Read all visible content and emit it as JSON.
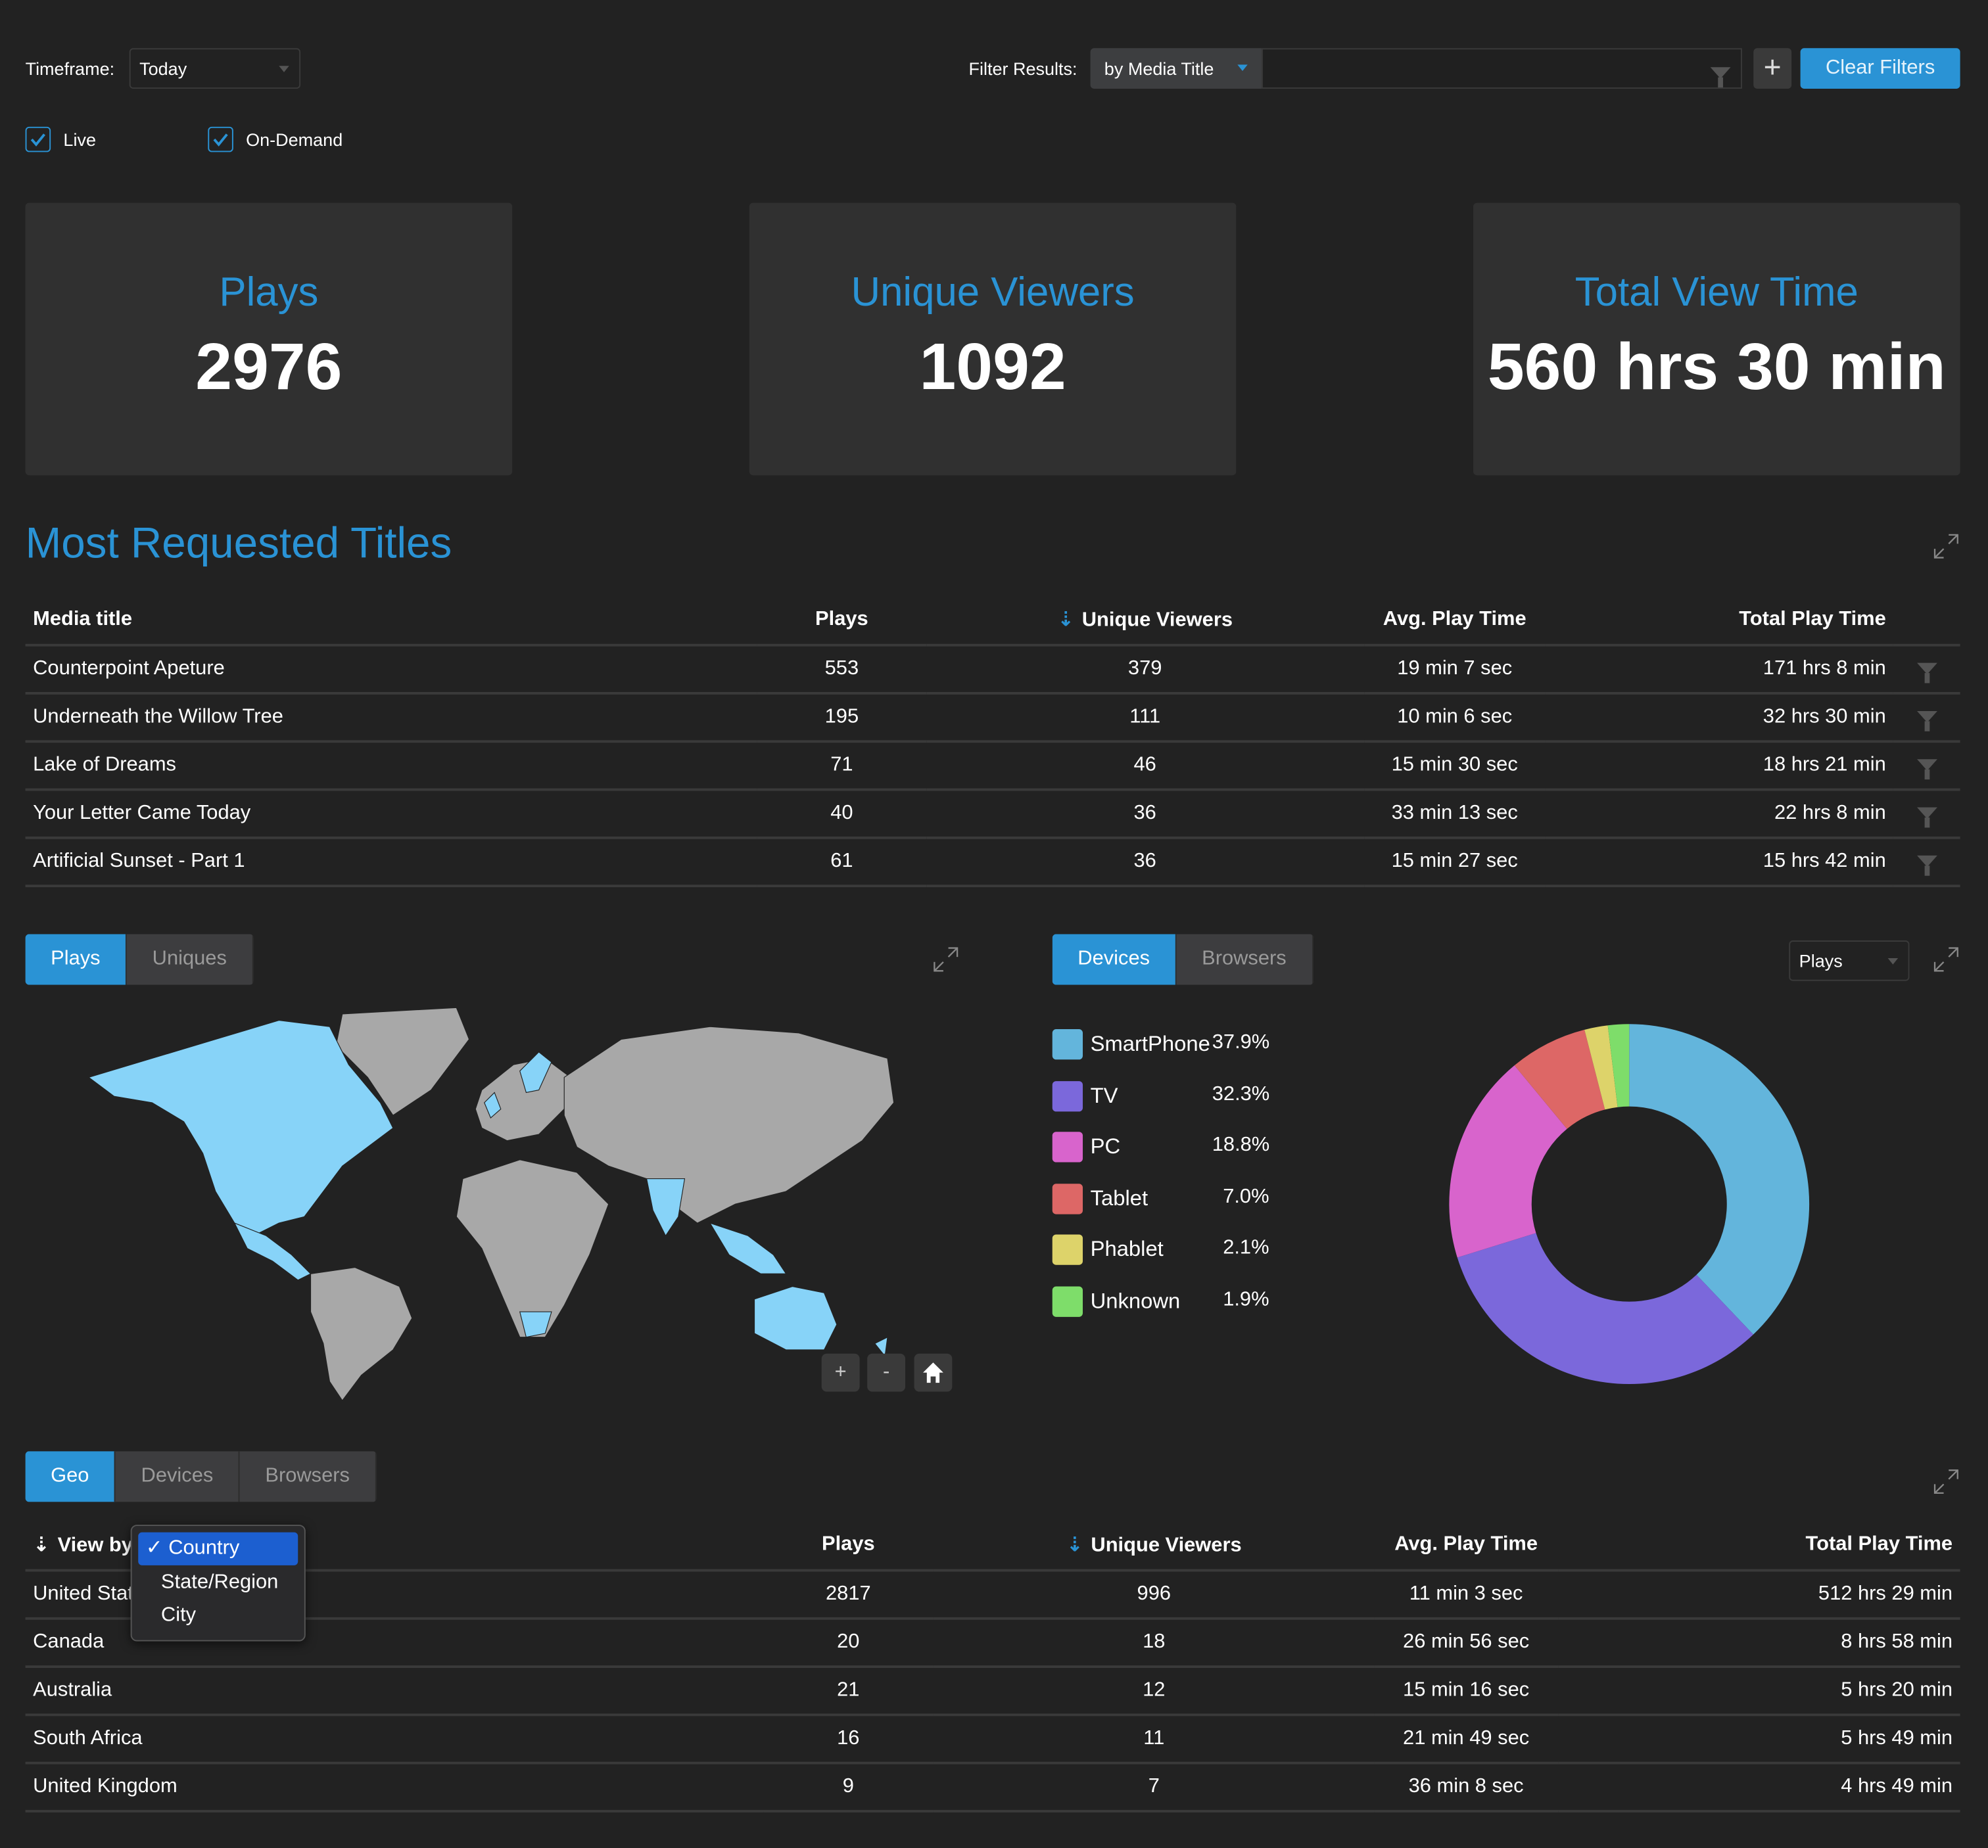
{
  "toolbar": {
    "timeframe_label": "Timeframe:",
    "timeframe_value": "Today",
    "filter_label": "Filter Results:",
    "filter_by_value": "by Media Title",
    "filter_input_value": "",
    "add_filter_label": "+",
    "clear_filters_label": "Clear Filters"
  },
  "checkboxes": [
    {
      "label": "Live",
      "checked": true
    },
    {
      "label": "On-Demand",
      "checked": true
    }
  ],
  "stats": [
    {
      "title": "Plays",
      "value": "2976"
    },
    {
      "title": "Unique Viewers",
      "value": "1092"
    },
    {
      "title": "Total View Time",
      "value": "560 hrs 30 min"
    }
  ],
  "titles_section": {
    "heading": "Most Requested Titles",
    "columns": [
      "Media title",
      "Plays",
      "Unique Viewers",
      "Avg. Play Time",
      "Total Play Time"
    ],
    "sorted_column": "Unique Viewers",
    "rows": [
      [
        "Counterpoint Apeture",
        "553",
        "379",
        "19 min 7 sec",
        "171 hrs 8 min"
      ],
      [
        "Underneath the Willow Tree",
        "195",
        "111",
        "10 min 6 sec",
        "32 hrs 30 min"
      ],
      [
        "Lake of Dreams",
        "71",
        "46",
        "15 min 30 sec",
        "18 hrs 21 min"
      ],
      [
        "Your Letter Came Today",
        "40",
        "36",
        "33 min 13 sec",
        "22 hrs 8 min"
      ],
      [
        "Artificial Sunset - Part 1",
        "61",
        "36",
        "15 min 27 sec",
        "15 hrs 42 min"
      ]
    ]
  },
  "map_panel": {
    "tabs": [
      "Plays",
      "Uniques"
    ],
    "active_tab": "Plays",
    "zoom_in": "+",
    "zoom_out": "-",
    "highlight_color": "#87d3f8",
    "land_color": "#a8a8a8"
  },
  "devices_panel": {
    "tabs": [
      "Devices",
      "Browsers"
    ],
    "active_tab": "Devices",
    "metric_select": "Plays"
  },
  "chart_data": {
    "type": "pie",
    "variant": "donut",
    "title": "",
    "categories": [
      "SmartPhone",
      "TV",
      "PC",
      "Tablet",
      "Phablet",
      "Unknown"
    ],
    "values": [
      37.9,
      32.3,
      18.8,
      7.0,
      2.1,
      1.9
    ],
    "labels": [
      "37.9%",
      "32.3%",
      "18.8%",
      "7.0%",
      "2.1%",
      "1.9%"
    ],
    "colors": [
      "#63b5dc",
      "#7b68db",
      "#d864cc",
      "#dd6766",
      "#ddd36a",
      "#7edd6a"
    ],
    "legend": "left"
  },
  "geo_section": {
    "tabs": [
      "Geo",
      "Devices",
      "Browsers"
    ],
    "active_tab": "Geo",
    "view_by_label": "View by",
    "view_by_options": [
      "Country",
      "State/Region",
      "City"
    ],
    "view_by_selected": "Country",
    "columns": [
      "Plays",
      "Unique Viewers",
      "Avg. Play Time",
      "Total Play Time"
    ],
    "sorted_column": "Unique Viewers",
    "rows": [
      [
        "United States",
        "2817",
        "996",
        "11 min 3 sec",
        "512 hrs 29 min"
      ],
      [
        "Canada",
        "20",
        "18",
        "26 min 56 sec",
        "8 hrs 58 min"
      ],
      [
        "Australia",
        "21",
        "12",
        "15 min 16 sec",
        "5 hrs 20 min"
      ],
      [
        "South Africa",
        "16",
        "11",
        "21 min 49 sec",
        "5 hrs 49 min"
      ],
      [
        "United Kingdom",
        "9",
        "7",
        "36 min 8 sec",
        "4 hrs 49 min"
      ]
    ]
  },
  "colors": {
    "accent": "#2a93d5",
    "background": "#222222",
    "card": "#303030"
  }
}
